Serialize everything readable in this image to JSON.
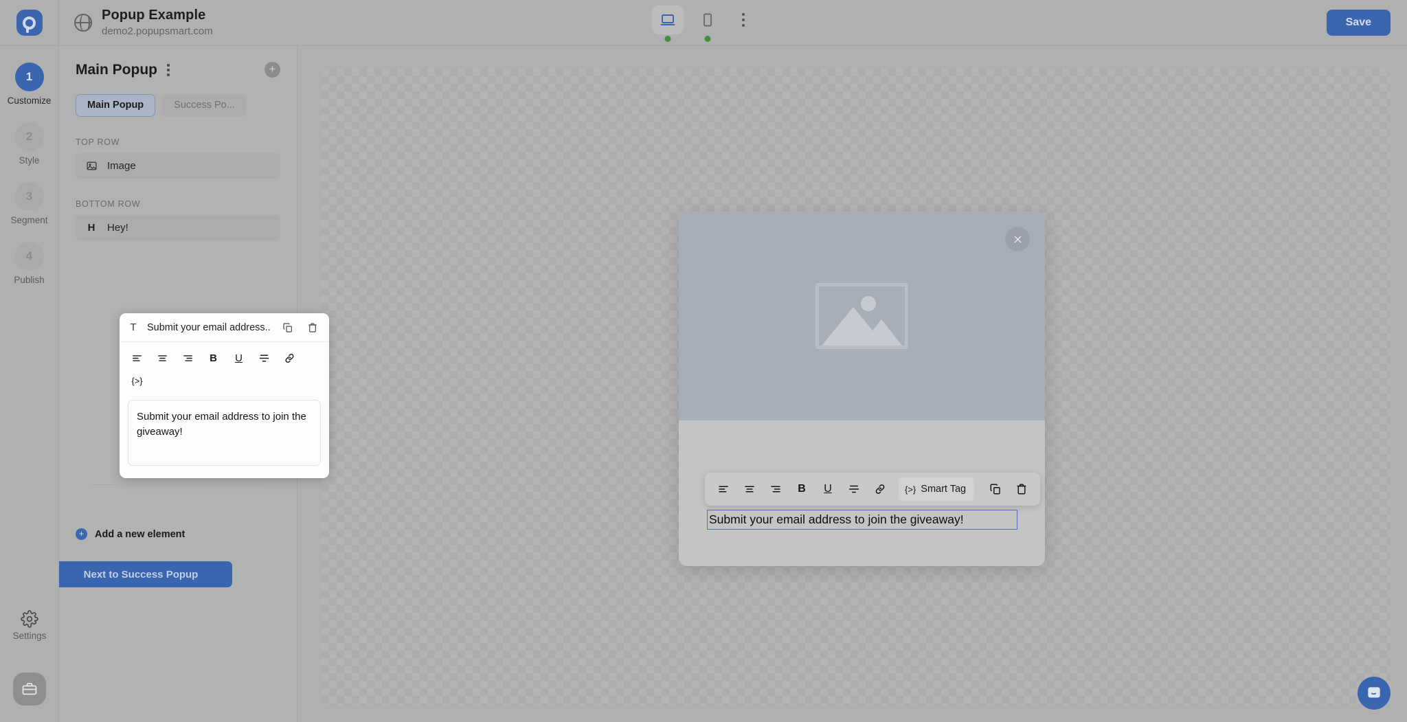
{
  "app": {
    "logo_icon": "popupsmart-logo-icon",
    "site_icon": "globe-icon",
    "site_title": "Popup Example",
    "site_url": "demo2.popupsmart.com",
    "save_label": "Save"
  },
  "device_toggle": {
    "desktop_icon": "desktop-icon",
    "mobile_icon": "mobile-icon",
    "more_icon": "kebab-menu-icon",
    "desktop_status": "online",
    "mobile_status": "online",
    "status_color": "#3f8f3f"
  },
  "rail": {
    "steps": [
      {
        "number": "1",
        "label": "Customize",
        "active": true
      },
      {
        "number": "2",
        "label": "Style",
        "active": false
      },
      {
        "number": "3",
        "label": "Segment",
        "active": false
      },
      {
        "number": "4",
        "label": "Publish",
        "active": false
      }
    ],
    "settings_label": "Settings",
    "settings_icon": "gear-icon",
    "briefcase_icon": "briefcase-icon"
  },
  "panel": {
    "title": "Main Popup",
    "kebab_icon": "kebab-menu-icon",
    "add_icon": "plus-circle-icon",
    "tabs": [
      {
        "label": "Main Popup",
        "active": true
      },
      {
        "label": "Success Po...",
        "active": false
      }
    ],
    "sections": [
      {
        "label": "TOP ROW",
        "items": [
          {
            "icon": "image-icon",
            "label": "Image"
          }
        ]
      },
      {
        "label": "BOTTOM ROW",
        "items": [
          {
            "icon": "heading-icon",
            "label": "Hey!"
          }
        ]
      }
    ],
    "add_element_label": "Add a new element",
    "add_element_icon": "plus-circle-icon",
    "next_button_label": "Next to Success Popup"
  },
  "element_editor": {
    "type_icon": "text-icon",
    "name": "Submit your email address...",
    "copy_icon": "copy-icon",
    "delete_icon": "trash-icon",
    "format_buttons": [
      {
        "icon": "align-left-icon",
        "glyph": ""
      },
      {
        "icon": "align-center-icon",
        "glyph": ""
      },
      {
        "icon": "align-right-icon",
        "glyph": ""
      },
      {
        "icon": "bold-icon",
        "glyph": "B"
      },
      {
        "icon": "underline-icon",
        "glyph": "U"
      },
      {
        "icon": "strikethrough-icon",
        "glyph": ""
      },
      {
        "icon": "link-icon",
        "glyph": ""
      },
      {
        "icon": "smart-tag-code-icon",
        "glyph": "{>}"
      }
    ],
    "text_value": "Submit your email address to join the giveaway!"
  },
  "canvas": {
    "popup": {
      "close_icon": "close-icon",
      "image_placeholder_icon": "image-placeholder-icon"
    },
    "toolbar": {
      "buttons": [
        {
          "icon": "align-left-icon",
          "glyph": ""
        },
        {
          "icon": "align-center-icon",
          "glyph": ""
        },
        {
          "icon": "align-right-icon",
          "glyph": ""
        },
        {
          "icon": "bold-icon",
          "glyph": "B"
        },
        {
          "icon": "underline-icon",
          "glyph": "U"
        },
        {
          "icon": "strikethrough-icon",
          "glyph": ""
        },
        {
          "icon": "link-icon",
          "glyph": ""
        }
      ],
      "smart_tag_label": "Smart Tag",
      "smart_tag_icon": "smart-tag-code-icon",
      "copy_icon": "copy-icon",
      "delete_icon": "trash-icon"
    },
    "selected_text": "Submit your email address to join the giveaway!",
    "selection_color": "#4a6fb5"
  },
  "chat_widget": {
    "icon": "chat-bubble-icon"
  },
  "colors": {
    "accent": "#3a66b0",
    "panel_bg": "#b2b2b2",
    "canvas_bg": "#b4b4b4"
  }
}
